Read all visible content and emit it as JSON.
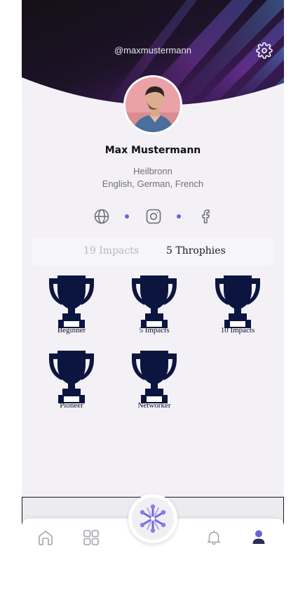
{
  "profile": {
    "handle": "@maxmustermann",
    "name": "Max Mustermann",
    "city": "Heilbronn",
    "languages": "English, German, French"
  },
  "social": {
    "icons": [
      "globe-icon",
      "instagram-icon",
      "facebook-icon"
    ]
  },
  "tabs": {
    "impacts_label": "19 Impacts",
    "trophies_label": "5 Throphies"
  },
  "trophies": [
    {
      "label": "Beginner"
    },
    {
      "label": "5 Impacts"
    },
    {
      "label": "10 Impacts"
    },
    {
      "label": "Pioneer"
    },
    {
      "label": "Networker"
    }
  ],
  "nav": {
    "items": [
      "home-icon",
      "grid-icon",
      "logo-icon",
      "bell-icon",
      "user-icon"
    ],
    "active": "user-icon"
  },
  "colors": {
    "accent": "#6b62d9",
    "trophy": "#0c1540",
    "header_dark": "#15101c",
    "header_purple": "#5a1f78"
  }
}
